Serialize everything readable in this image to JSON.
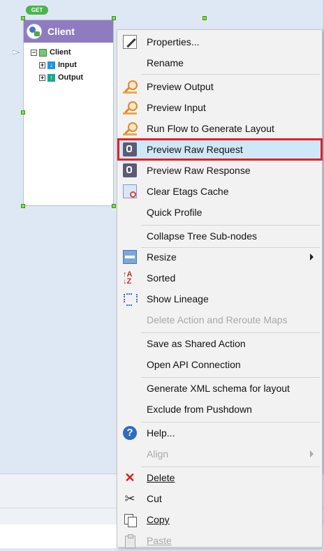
{
  "node": {
    "badge": "GET",
    "title": "Client",
    "tree": {
      "root": "Client",
      "children": [
        "Input",
        "Output"
      ]
    }
  },
  "menu": {
    "items": [
      {
        "label": "Properties...",
        "icon": "properties-icon"
      },
      {
        "label": "Rename"
      },
      {
        "label": "Preview Output",
        "icon": "preview-magnifier-icon"
      },
      {
        "label": "Preview Input",
        "icon": "preview-magnifier-icon"
      },
      {
        "label": "Run Flow to Generate Layout",
        "icon": "preview-magnifier-icon"
      },
      {
        "label": "Preview Raw Request",
        "icon": "raw-request-icon",
        "highlighted": true
      },
      {
        "label": "Preview Raw Response",
        "icon": "raw-response-icon"
      },
      {
        "label": "Clear Etags Cache",
        "icon": "clear-cache-icon"
      },
      {
        "label": "Quick Profile"
      },
      {
        "label": "Collapse Tree Sub-nodes"
      },
      {
        "label": "Resize",
        "icon": "resize-icon",
        "submenu": true
      },
      {
        "label": "Sorted",
        "icon": "sort-az-icon"
      },
      {
        "label": "Show Lineage",
        "icon": "lineage-icon"
      },
      {
        "label": "Delete Action and Reroute Maps",
        "disabled": true
      },
      {
        "label": "Save as Shared Action"
      },
      {
        "label": "Open API Connection"
      },
      {
        "label": "Generate XML schema for layout"
      },
      {
        "label": "Exclude from Pushdown"
      },
      {
        "label": "Help...",
        "icon": "help-icon"
      },
      {
        "label": "Align",
        "disabled": true,
        "submenu": true
      },
      {
        "label": "Delete",
        "icon": "delete-icon"
      },
      {
        "label": "Cut",
        "icon": "cut-icon"
      },
      {
        "label": "Copy",
        "icon": "copy-icon"
      },
      {
        "label": "Paste",
        "icon": "paste-icon",
        "disabled": true
      }
    ],
    "highlight_color": "#e0202a"
  }
}
